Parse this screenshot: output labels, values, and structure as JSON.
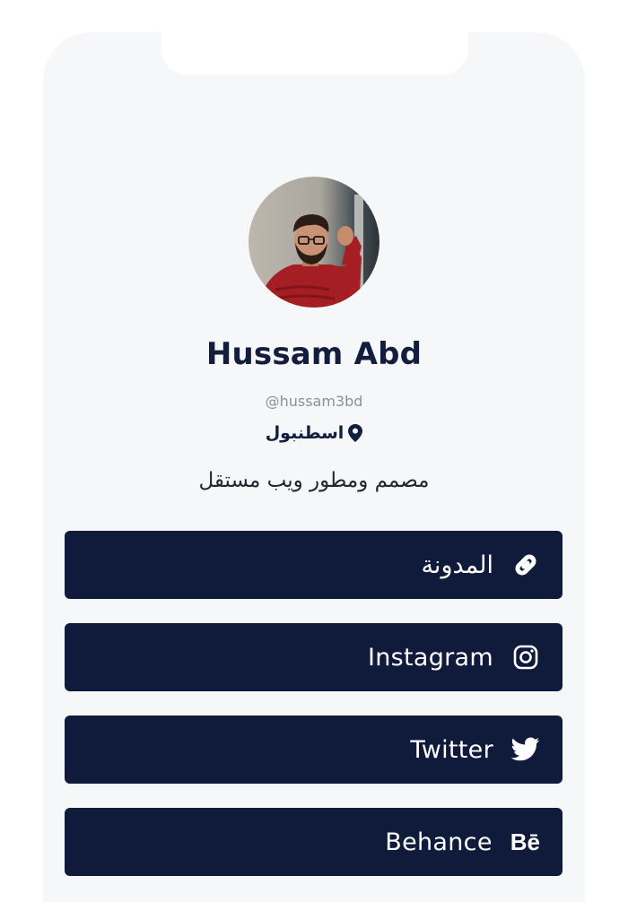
{
  "profile": {
    "name": "Hussam Abd",
    "handle": "@hussam3bd",
    "location": "اسطنبول",
    "bio": "مصمم ومطور ويب مستقل",
    "avatar_icon": "profile-photo"
  },
  "links": [
    {
      "label": "المدونة",
      "icon": "link-icon"
    },
    {
      "label": "Instagram",
      "icon": "instagram-icon"
    },
    {
      "label": "Twitter",
      "icon": "twitter-icon"
    },
    {
      "label": "Behance",
      "icon": "behance-icon",
      "icon_text": "Bē"
    }
  ],
  "colors": {
    "button_bg": "#101b3c",
    "name_text": "#131d3d",
    "page_bg": "#f6f7f9"
  }
}
